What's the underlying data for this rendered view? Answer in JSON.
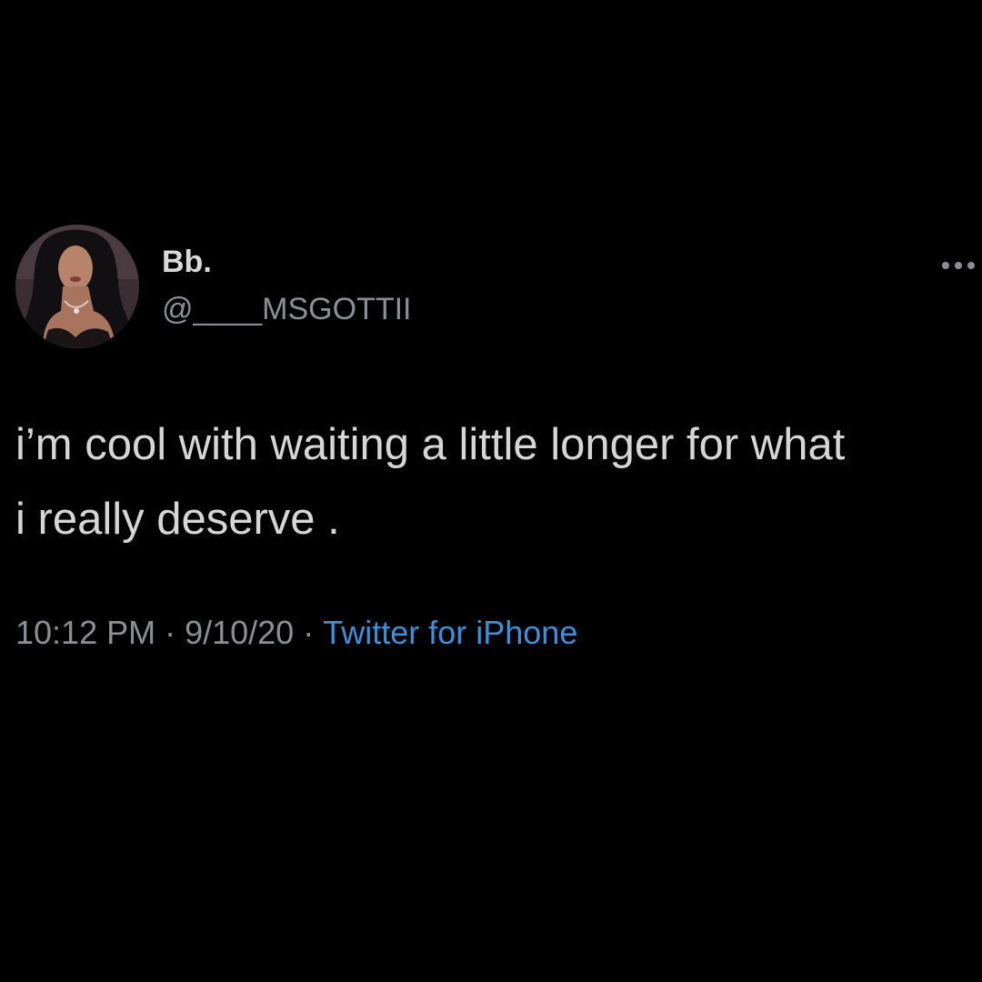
{
  "tweet": {
    "author": {
      "display_name": "Bb.",
      "handle": "@____MSGOTTII",
      "avatar_icon": "profile-photo"
    },
    "more_icon": "more-horizontal-icon",
    "text_lines": [
      "i’m cool with waiting a little longer for what",
      "i really deserve ."
    ],
    "meta": {
      "time": "10:12 PM",
      "separator": "·",
      "date": "9/10/20",
      "source": "Twitter for iPhone"
    }
  },
  "colors": {
    "background": "#000000",
    "text": "#d6d6d6",
    "secondary_text": "#8b8f94",
    "link": "#3d8fd8"
  }
}
